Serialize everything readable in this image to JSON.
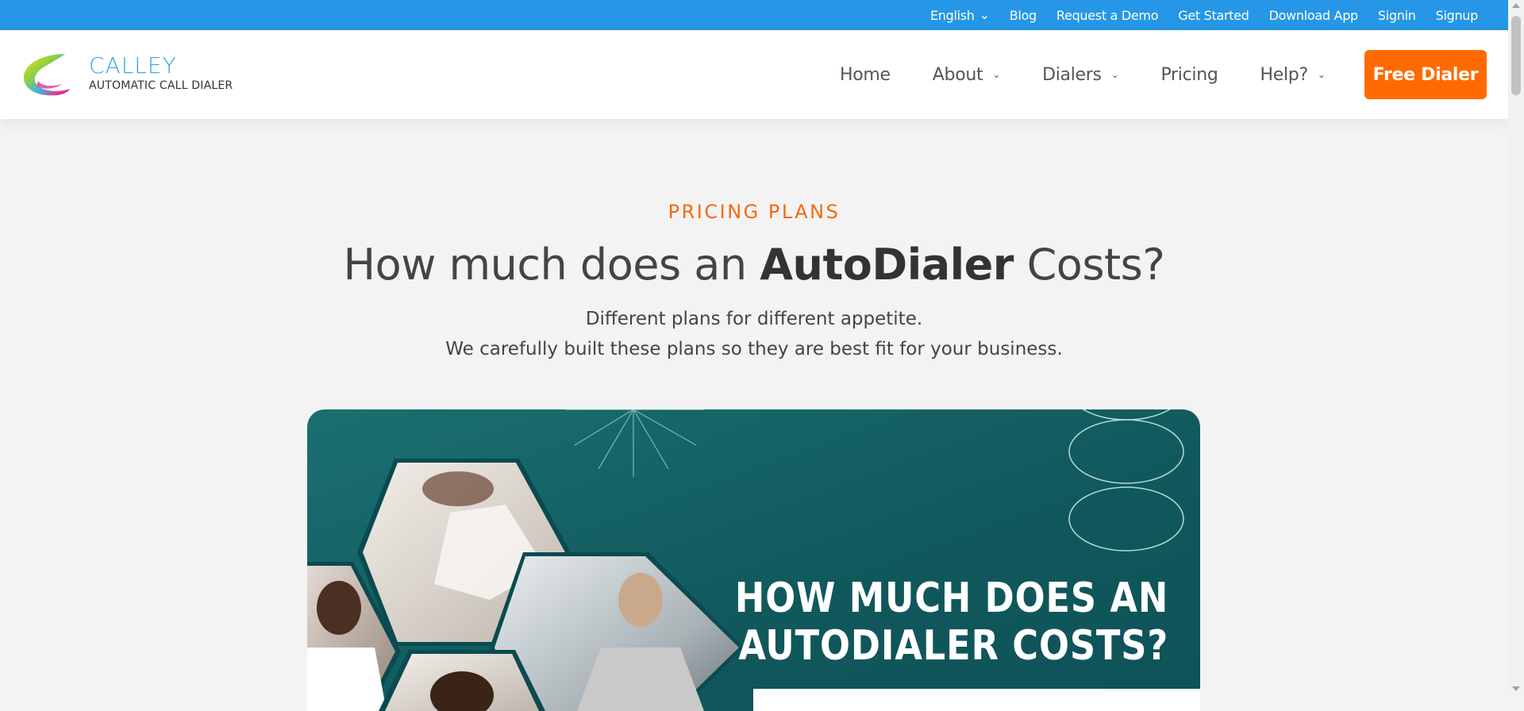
{
  "topbar": {
    "links": [
      "English",
      "Blog",
      "Request a Demo",
      "Get Started",
      "Download App",
      "Signin",
      "Signup"
    ]
  },
  "brand": {
    "name": "CALLEY",
    "tagline": "AUTOMATIC CALL DIALER"
  },
  "nav": {
    "home": "Home",
    "about": "About",
    "dialers": "Dialers",
    "pricing": "Pricing",
    "help": "Help?",
    "cta": "Free Dialer"
  },
  "hero": {
    "eyebrow": "PRICING PLANS",
    "headline_pre": "How much does an ",
    "headline_bold": "AutoDialer",
    "headline_post": " Costs?",
    "sub1": "Different plans for different appetite.",
    "sub2": "We carefully built these plans so they are best fit for your business."
  },
  "banner": {
    "title_line1": "HOW MUCH DOES AN",
    "title_line2": "AUTODIALER COSTS?"
  },
  "colors": {
    "topbar": "#2597e6",
    "accent": "#ff6a00",
    "brand_blue": "#36a4e3",
    "banner_teal": "#10585c"
  }
}
